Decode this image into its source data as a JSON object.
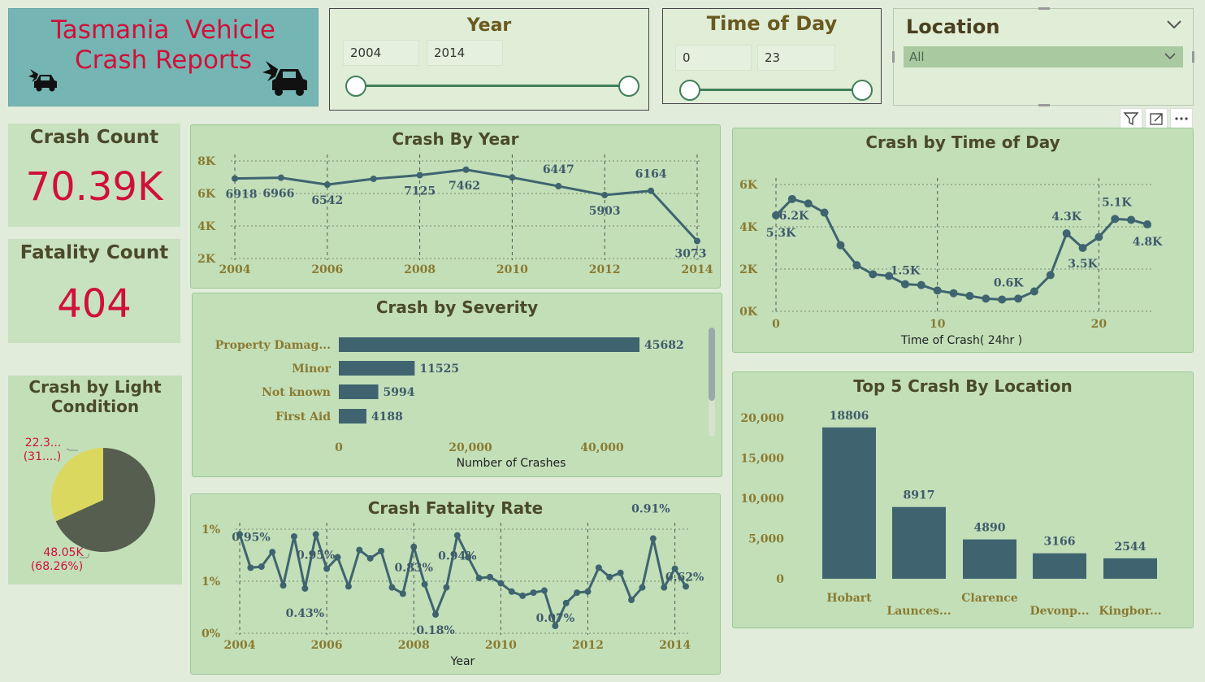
{
  "header": {
    "title_line1": "Tasmania  Vehicle",
    "title_line2": "Crash Reports",
    "bg_color": "#75b6b4",
    "title_color": "#d0103a"
  },
  "slicers": {
    "year": {
      "title": "Year",
      "from": "2004",
      "to": "2014"
    },
    "time": {
      "title": "Time of Day",
      "from": "0",
      "to": "23"
    },
    "location": {
      "title": "Location",
      "value": "All"
    }
  },
  "kpis": {
    "crash_count_label": "Crash Count",
    "crash_count_value": "70.39K",
    "fatality_count_label": "Fatality Count",
    "fatality_count_value": "404",
    "value_color": "#d0103a"
  },
  "colors": {
    "series": "#3f6470",
    "pie_dark": "#565e50",
    "pie_light": "#dbd860",
    "tick": "#8a7a30"
  },
  "chart_data": [
    {
      "id": "crash_by_year",
      "type": "line",
      "title": "Crash By Year",
      "x": [
        2004,
        2005,
        2006,
        2007,
        2008,
        2009,
        2010,
        2011,
        2012,
        2013,
        2014
      ],
      "values": [
        6918,
        6966,
        6542,
        6900,
        7125,
        7462,
        6980,
        6447,
        5903,
        6164,
        3073
      ],
      "data_labels": {
        "2004": "6918",
        "2005": "6966",
        "2006": "6542",
        "2008": "7125",
        "2009": "7462",
        "2011": "6447",
        "2012": "5903",
        "2013": "6164",
        "2014": "3073"
      },
      "xticks": [
        "2004",
        "2006",
        "2008",
        "2010",
        "2012",
        "2014"
      ],
      "yticks": [
        "2K",
        "4K",
        "6K",
        "8K"
      ],
      "ylim": [
        2000,
        8000
      ]
    },
    {
      "id": "crash_by_time",
      "type": "line",
      "title": "Crash by Time of Day",
      "xlabel": "Time of Crash( 24hr )",
      "x": [
        0,
        1,
        2,
        3,
        4,
        5,
        6,
        7,
        8,
        9,
        10,
        11,
        12,
        13,
        14,
        15,
        16,
        17,
        18,
        19,
        20,
        21,
        22,
        23
      ],
      "values": [
        5300,
        6200,
        5950,
        5450,
        3650,
        2550,
        2050,
        1950,
        1500,
        1450,
        1150,
        1000,
        850,
        700,
        650,
        700,
        1100,
        2000,
        4300,
        3500,
        4100,
        5100,
        5050,
        4800
      ],
      "data_labels": {
        "0": "5.3K",
        "1": "6.2K",
        "8": "1.5K",
        "14": "0.6K",
        "18": "4.3K",
        "19": "3.5K",
        "21": "5.1K",
        "23": "4.8K"
      },
      "xticks": [
        "0",
        "10",
        "20"
      ],
      "yticks": [
        "0K",
        "2K",
        "4K",
        "6K"
      ],
      "ylim": [
        0,
        7000
      ]
    },
    {
      "id": "crash_by_severity",
      "type": "bar",
      "orientation": "horizontal",
      "title": "Crash by Severity",
      "xlabel": "Number of Crashes",
      "categories": [
        "Property Damag...",
        "Minor",
        "Not known",
        "First Aid"
      ],
      "values": [
        45682,
        11525,
        5994,
        4188
      ],
      "value_labels": [
        "45682",
        "11525",
        "5994",
        "4188"
      ],
      "xticks": [
        "0",
        "20,000",
        "40,000"
      ],
      "xlim": [
        0,
        50000
      ]
    },
    {
      "id": "crash_by_light",
      "type": "pie",
      "title": "Crash by Light Condition",
      "slices": [
        {
          "label": "48.05K",
          "pct": "(68.26%)",
          "value": 68.26
        },
        {
          "label": "22.3...",
          "pct": "(31....)",
          "value": 31.74
        }
      ]
    },
    {
      "id": "crash_fatality_rate",
      "type": "line",
      "title": "Crash Fatality Rate",
      "xlabel": "Year",
      "x": [
        2004,
        2004.25,
        2004.5,
        2004.75,
        2005,
        2005.25,
        2005.5,
        2005.75,
        2006,
        2006.25,
        2006.5,
        2006.75,
        2007,
        2007.25,
        2007.5,
        2007.75,
        2008,
        2008.25,
        2008.5,
        2008.75,
        2009,
        2009.25,
        2009.5,
        2009.75,
        2010,
        2010.25,
        2010.5,
        2010.75,
        2011,
        2011.25,
        2011.5,
        2011.75,
        2012,
        2012.25,
        2012.5,
        2012.75,
        2013,
        2013.25,
        2013.5,
        2013.75,
        2014,
        2014.25
      ],
      "values": [
        0.95,
        0.63,
        0.64,
        0.78,
        0.46,
        0.93,
        0.43,
        0.95,
        0.62,
        0.73,
        0.45,
        0.8,
        0.72,
        0.79,
        0.44,
        0.38,
        0.83,
        0.47,
        0.18,
        0.44,
        0.94,
        0.73,
        0.53,
        0.54,
        0.48,
        0.4,
        0.36,
        0.39,
        0.41,
        0.07,
        0.29,
        0.39,
        0.4,
        0.63,
        0.54,
        0.58,
        0.32,
        0.44,
        0.91,
        0.44,
        0.62,
        0.45
      ],
      "data_labels": {
        "2004": "0.95%",
        "2005.75": "0.95%",
        "2005.5": "0.43%",
        "2008": "0.83%",
        "2008.5": "0.18%",
        "2009": "0.94%",
        "2011.25": "0.07%",
        "2013.5": "0.91%",
        "2014": "0.62%"
      },
      "xticks": [
        "2004",
        "2006",
        "2008",
        "2010",
        "2012",
        "2014"
      ],
      "yticks": [
        "0%",
        "1%",
        "1%"
      ],
      "ylim": [
        0,
        1
      ]
    },
    {
      "id": "top5_location",
      "type": "bar",
      "title": "Top 5 Crash By Location",
      "categories": [
        "Hobart",
        "Launces...",
        "Clarence",
        "Devonp...",
        "Kingbor..."
      ],
      "values": [
        18806,
        8917,
        4890,
        3166,
        2544
      ],
      "value_labels": [
        "18806",
        "8917",
        "4890",
        "3166",
        "2544"
      ],
      "yticks": [
        "0",
        "5,000",
        "10,000",
        "15,000",
        "20,000"
      ],
      "ylim": [
        0,
        20000
      ]
    }
  ]
}
